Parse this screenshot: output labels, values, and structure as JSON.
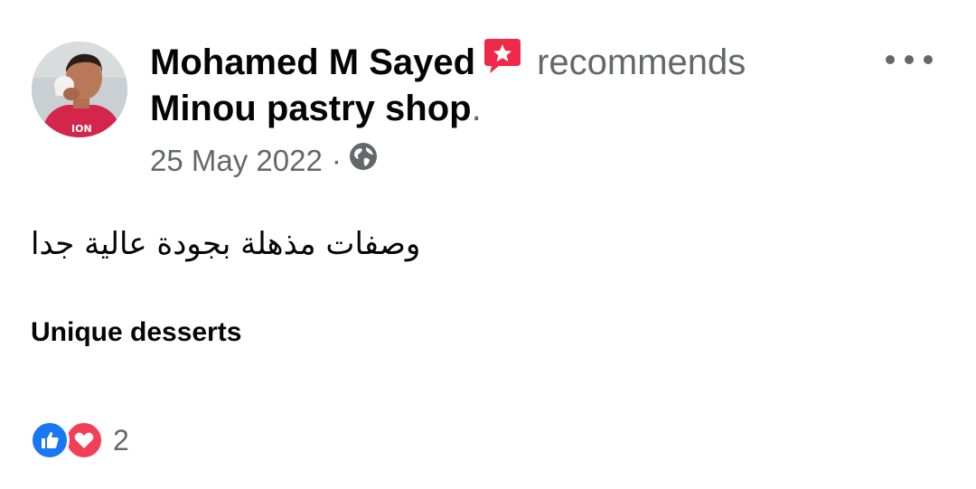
{
  "post": {
    "author": "Mohamed M Sayed",
    "action": "recommends",
    "page_name": "Minou pastry shop",
    "period": ".",
    "date": "25 May 2022",
    "separator": "·",
    "privacy_icon": "globe-icon",
    "recommend_icon": "recommendation-star-icon",
    "body_arabic": "وصفات مذهلة بجودة عالية جدا",
    "body_tag": "Unique desserts",
    "reactions": {
      "icons": [
        "like-icon",
        "love-icon"
      ],
      "count": "2"
    },
    "colors": {
      "text_primary": "#050505",
      "text_secondary": "#65676b",
      "like_blue": "#1877f2",
      "love_red": "#f33e58",
      "recommend_red": "#f02849"
    }
  }
}
